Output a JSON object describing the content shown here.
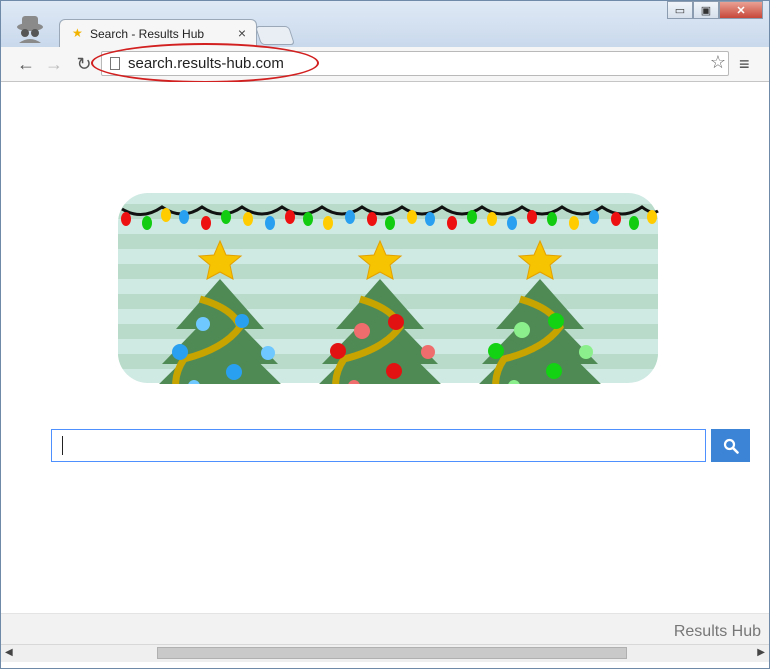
{
  "browser": {
    "tab_title": "Search - Results Hub",
    "tab_close": "×",
    "url": "search.results-hub.com",
    "window_buttons": {
      "minimize": "▭",
      "maximize": "▣",
      "close": "✕"
    },
    "nav": {
      "back": "←",
      "forward": "→",
      "reload": "↻"
    },
    "icons": {
      "star": "☆",
      "menu": "≡",
      "tab_favicon": "★"
    }
  },
  "page": {
    "search_input_value": "",
    "footer_brand": "Results Hub"
  },
  "colors": {
    "accent": "#3b84d6",
    "annotation": "#d21f1f"
  }
}
